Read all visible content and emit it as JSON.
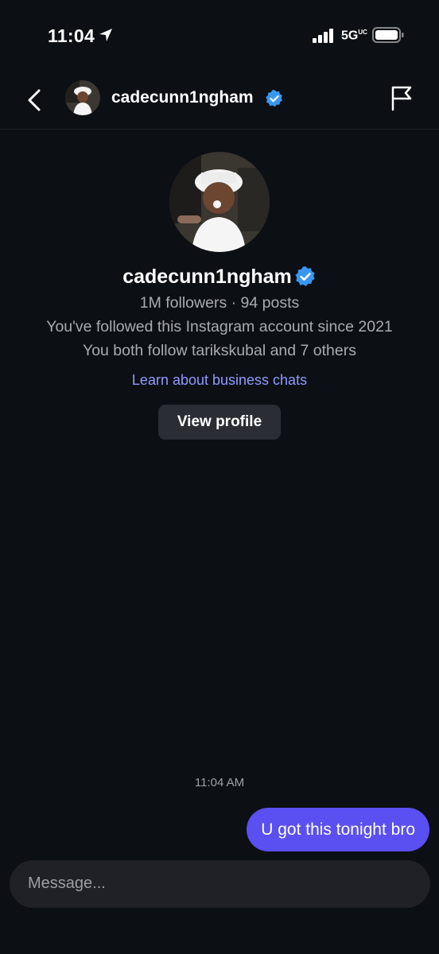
{
  "status_bar": {
    "time": "11:04",
    "network": "5G",
    "network_suffix": "UC"
  },
  "header": {
    "username": "cadecunn1ngham",
    "back_icon": "chevron-left-icon",
    "report_icon": "flag-icon"
  },
  "profile": {
    "username": "cadecunn1ngham",
    "stats": "1M followers · 94 posts",
    "followed_since": "You've followed this Instagram account since 2021",
    "mutual_follows": "You both follow tarikskubal and 7 others",
    "learn_link": "Learn about business chats",
    "view_profile_label": "View profile"
  },
  "messages": [
    {
      "timestamp": "11:04 AM",
      "text": "U got this tonight bro",
      "sender": "me"
    }
  ],
  "composer": {
    "placeholder": "Message..."
  },
  "colors": {
    "background": "#0c0f14",
    "sent_bubble": "#5a4ff0",
    "link": "#8f9cff",
    "verified": "#3897f0"
  }
}
